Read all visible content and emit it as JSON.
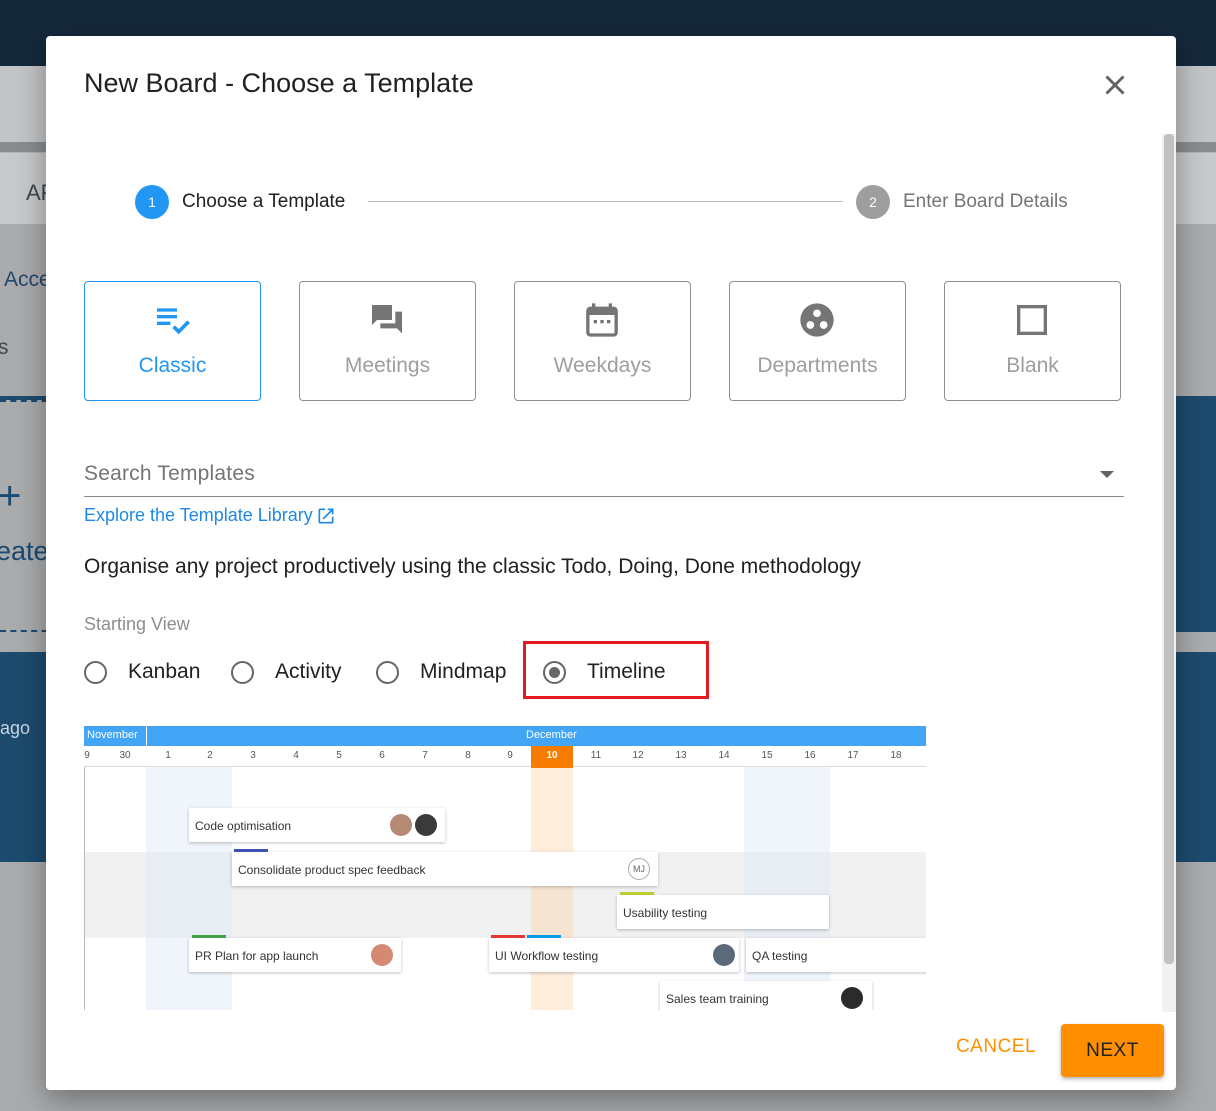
{
  "background": {
    "fragments": [
      "AP",
      "Acce",
      "s",
      "+",
      "eate",
      "ago"
    ]
  },
  "modal": {
    "title": "New Board - Choose a Template",
    "close_icon": "close-icon"
  },
  "stepper": {
    "steps": [
      {
        "number": "1",
        "label": "Choose a Template",
        "active": true
      },
      {
        "number": "2",
        "label": "Enter Board Details",
        "active": false
      }
    ]
  },
  "templates": [
    {
      "label": "Classic",
      "icon": "checklist-icon",
      "selected": true
    },
    {
      "label": "Meetings",
      "icon": "chat-bubbles-icon",
      "selected": false
    },
    {
      "label": "Weekdays",
      "icon": "calendar-icon",
      "selected": false
    },
    {
      "label": "Departments",
      "icon": "workspaces-icon",
      "selected": false
    },
    {
      "label": "Blank",
      "icon": "square-outline-icon",
      "selected": false
    }
  ],
  "search": {
    "placeholder": "Search Templates"
  },
  "explore_link": "Explore the Template Library",
  "description": "Organise any project productively using the classic Todo, Doing, Done methodology",
  "starting_view": {
    "label": "Starting View",
    "options": [
      "Kanban",
      "Activity",
      "Mindmap",
      "Timeline"
    ],
    "selected": "Timeline"
  },
  "preview": {
    "months": [
      "November",
      "December"
    ],
    "days": [
      "9",
      "30",
      "1",
      "2",
      "3",
      "4",
      "5",
      "6",
      "7",
      "8",
      "9",
      "10",
      "11",
      "12",
      "13",
      "14",
      "15",
      "16",
      "17",
      "18"
    ],
    "today": "10",
    "cards": [
      {
        "text": "Code optimisation",
        "bar_color": ""
      },
      {
        "text": "Consolidate product spec feedback",
        "bar_color": "#3f51b5",
        "avatar": "MJ"
      },
      {
        "text": "Usability testing",
        "bar_color": "#c0ca33"
      },
      {
        "text": "PR Plan for app launch",
        "bar_color": "#43a047"
      },
      {
        "text": "UI Workflow testing",
        "bar_color": "#e53935"
      },
      {
        "text": "QA testing",
        "bar_color": "#039be5"
      },
      {
        "text": "Sales team training",
        "bar_color": ""
      }
    ]
  },
  "footer": {
    "cancel": "CANCEL",
    "next": "NEXT"
  },
  "colors": {
    "accent": "#2196f3",
    "next_button": "#ff8f00",
    "highlight": "#e21b23"
  }
}
